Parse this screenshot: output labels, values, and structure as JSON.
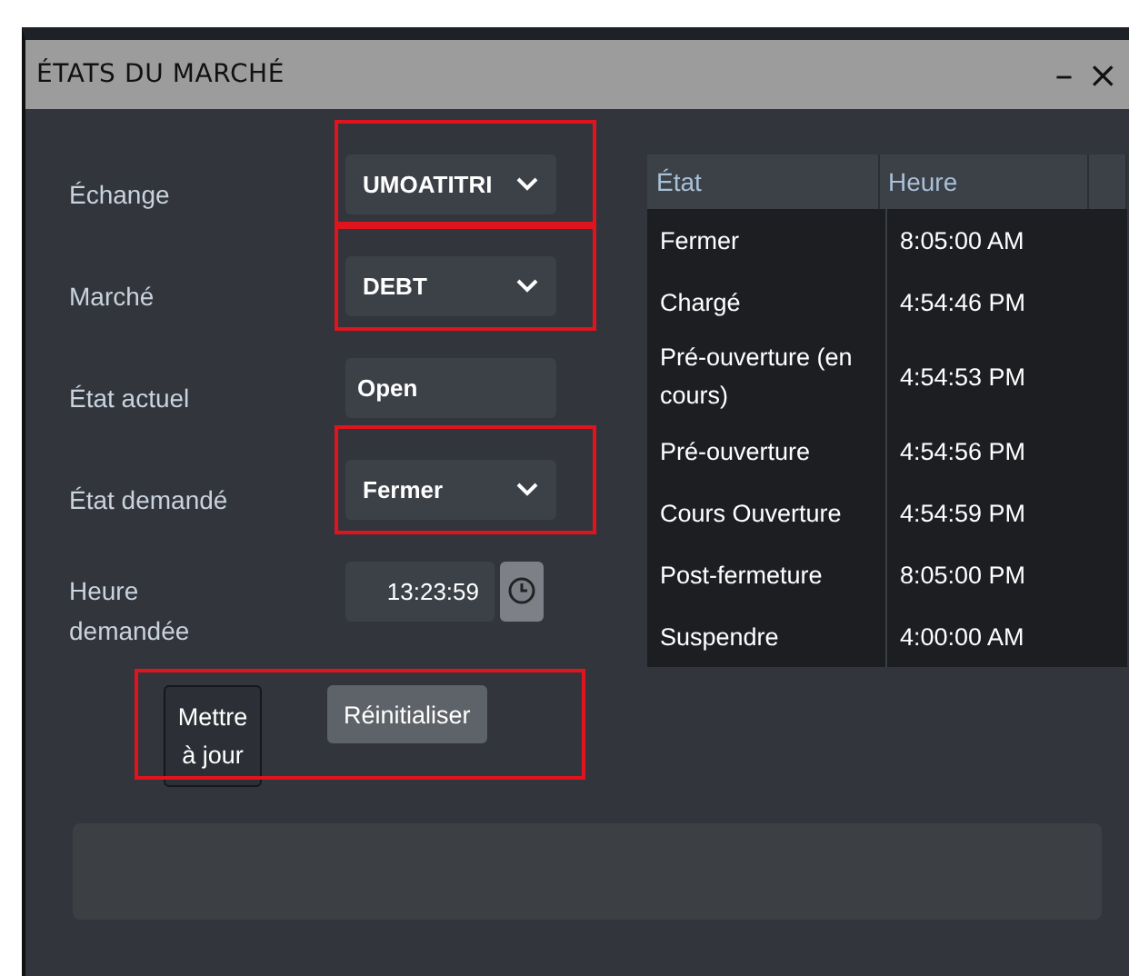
{
  "window": {
    "title": "ÉTATS DU MARCHÉ",
    "controls": [
      "–",
      "×"
    ]
  },
  "form": [
    {
      "kind": "select",
      "label": "Échange",
      "value": "UMOATITRI",
      "highlighted": true
    },
    {
      "kind": "select",
      "label": "Marché",
      "value": "DEBT",
      "highlighted": true
    },
    {
      "kind": "text",
      "label": "État actuel",
      "value": "Open",
      "highlighted": false
    },
    {
      "kind": "select",
      "label": "État demandé",
      "value": "Fermer",
      "highlighted": true
    },
    {
      "kind": "time",
      "label": "Heure demandée",
      "value": "13:23:59",
      "highlighted": false
    }
  ],
  "buttons": {
    "highlighted": true,
    "items": [
      {
        "label": "Mettre à jour",
        "kind": "primary"
      },
      {
        "label": "Réinitialiser",
        "kind": "secondary"
      }
    ]
  },
  "table": {
    "columns": [
      "État",
      "Heure"
    ],
    "rows": [
      {
        "state": "Fermer",
        "time": "8:05:00 AM"
      },
      {
        "state": "Chargé",
        "time": "4:54:46 PM"
      },
      {
        "state": "Pré-ouverture (en cours)",
        "time": "4:54:53 PM"
      },
      {
        "state": "Pré-ouverture",
        "time": "4:54:56 PM"
      },
      {
        "state": "Cours Ouverture",
        "time": "4:54:59 PM"
      },
      {
        "state": "Post-fermeture",
        "time": "8:05:00 PM"
      },
      {
        "state": "Suspendre",
        "time": "4:00:00 AM"
      }
    ]
  }
}
